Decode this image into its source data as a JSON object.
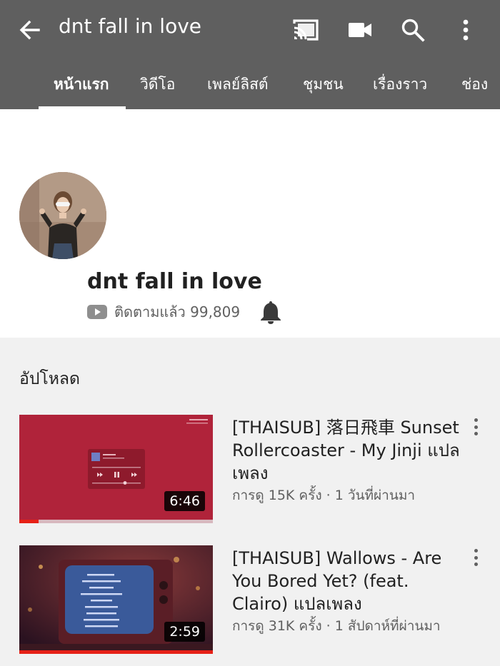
{
  "header": {
    "search_query": "dnt fall in love",
    "icons": [
      "back-arrow-icon",
      "cast-icon",
      "video-camera-icon",
      "search-icon",
      "more-vert-icon"
    ]
  },
  "tabs": [
    {
      "label": "หน้าแรก",
      "active": true
    },
    {
      "label": "วิดีโอ",
      "active": false
    },
    {
      "label": "เพลย์ลิสต์",
      "active": false
    },
    {
      "label": "ชุมชน",
      "active": false
    },
    {
      "label": "เรื่องราว",
      "active": false
    },
    {
      "label": "ช่อง",
      "active": false
    }
  ],
  "channel": {
    "name": "dnt fall in love",
    "subscribed_label": "ติดตามแล้ว 99,809"
  },
  "uploads": {
    "section_title": "อัปโหลด",
    "videos": [
      {
        "title": "[THAISUB] 落日飛車 Sunset Rollercoaster - My Jinji แปลเพลง",
        "meta": "การดู 15K ครั้ง · 1 วันที่ผ่านมา",
        "duration": "6:46",
        "watched_fraction": 0.1
      },
      {
        "title": "[THAISUB] Wallows - Are You Bored Yet? (feat. Clairo) แปลเพลง",
        "meta": "การดู 31K ครั้ง · 1 สัปดาห์ที่ผ่านมา",
        "duration": "2:59",
        "watched_fraction": 1.0
      }
    ]
  },
  "colors": {
    "appbar": "#5f5f5f",
    "accent_red": "#e62117",
    "thumb1_bg": "#b0233a",
    "thumb2_bg": "#4a1f2a"
  }
}
